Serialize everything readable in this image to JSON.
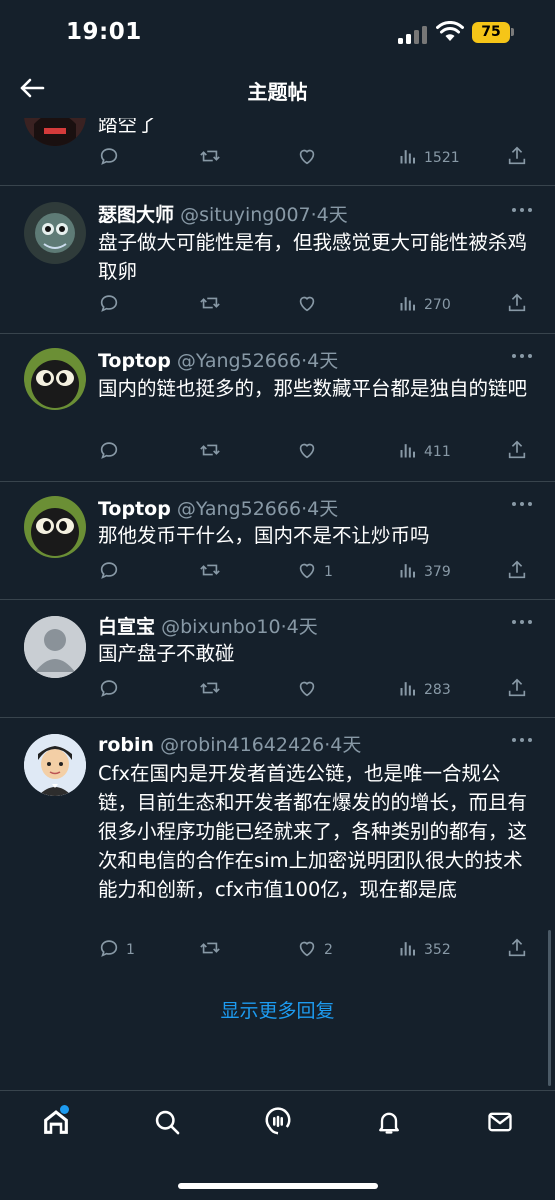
{
  "status_bar": {
    "time": "19:01",
    "battery": "75"
  },
  "header": {
    "title": "主题帖"
  },
  "replies": [
    {
      "text": "踏空了",
      "actions": {
        "replies": "",
        "retweets": "",
        "likes": "",
        "views": "1521"
      }
    },
    {
      "name": "瑟图大师",
      "handle": "@situying007",
      "dot": "·",
      "time": "4天",
      "text": "盘子做大可能性是有，但我感觉更大可能性被杀鸡取卵",
      "actions": {
        "replies": "",
        "retweets": "",
        "likes": "",
        "views": "270"
      }
    },
    {
      "name": "Toptop",
      "handle": "@Yang52666",
      "dot": "·",
      "time": "4天",
      "text": "国内的链也挺多的，那些数藏平台都是独自的链吧",
      "actions": {
        "replies": "",
        "retweets": "",
        "likes": "",
        "views": "411"
      }
    },
    {
      "name": "Toptop",
      "handle": "@Yang52666",
      "dot": "·",
      "time": "4天",
      "text": "那他发币干什么，国内不是不让炒币吗",
      "actions": {
        "replies": "",
        "retweets": "",
        "likes": "1",
        "views": "379"
      }
    },
    {
      "name": "白宣宝",
      "handle": "@bixunbo10",
      "dot": "·",
      "time": "4天",
      "text": "国产盘子不敢碰",
      "actions": {
        "replies": "",
        "retweets": "",
        "likes": "",
        "views": "283"
      }
    },
    {
      "name": "robin",
      "handle": "@robin41642426",
      "dot": "·",
      "time": "4天",
      "text": "Cfx在国内是开发者首选公链，也是唯一合规公链，目前生态和开发者都在爆发的的增长，而且有很多小程序功能已经就来了，各种类别的都有，这次和电信的合作在sim上加密说明团队很大的技术能力和创新，cfx市值100亿，现在都是底",
      "actions": {
        "replies": "1",
        "retweets": "",
        "likes": "2",
        "views": "352"
      }
    }
  ],
  "show_more": "显示更多回复",
  "tabs": [
    "home-icon",
    "search-icon",
    "spaces-icon",
    "notifications-icon",
    "messages-icon"
  ],
  "colors": {
    "background": "#15202b",
    "accent": "#1d9bf0",
    "muted": "#8899a6",
    "divider": "#38444d",
    "battery": "#f5c518"
  }
}
